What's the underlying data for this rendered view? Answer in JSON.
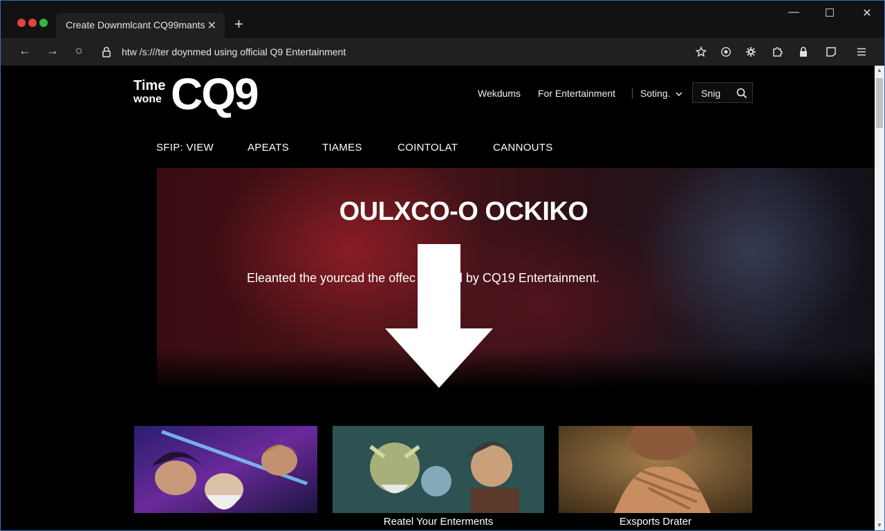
{
  "browser": {
    "tab_title": "Create Downmlcant CQ99mants",
    "tab_close": "✕",
    "new_tab": "+",
    "url": "htw /s:///ter doynmed using official  Q9 Entertainment",
    "controls": {
      "minimize": "—",
      "maximize": "☐",
      "close": "✕"
    },
    "nav": {
      "back": "←",
      "forward": "→",
      "reload": "○"
    },
    "traffic_colors": [
      "#e0443e",
      "#e0443e",
      "#2fb84a"
    ]
  },
  "header": {
    "logo_small_line1": "Time",
    "logo_small_line2": "wone",
    "logo_big": "CQ9",
    "links": [
      "Wekdums",
      "For Entertainment",
      "Soting."
    ],
    "search_label": "Snig"
  },
  "main_nav": [
    "SFIP: VIEW",
    "APEATS",
    "TIAMES",
    "COINTOLAT",
    "CANNOUTS"
  ],
  "hero": {
    "title": "OULXCO-O OCKIKO",
    "subtitle": "Eleanted the yourcad the offec           you fled by CQ19 Entertainment."
  },
  "cards": [
    {
      "label": ""
    },
    {
      "label": "Reatel Your Enterments"
    },
    {
      "label": "Exsports Drater"
    }
  ]
}
